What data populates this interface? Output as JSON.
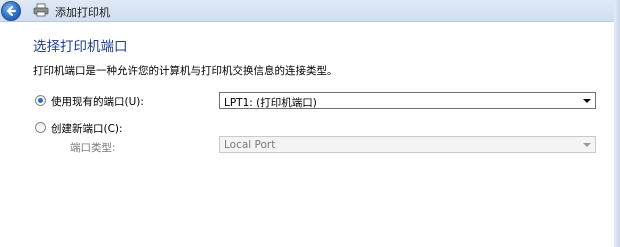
{
  "window": {
    "title": "添加打印机"
  },
  "page": {
    "heading": "选择打印机端口",
    "description": "打印机端口是一种允许您的计算机与打印机交换信息的连接类型。"
  },
  "options": {
    "use_existing": {
      "label": "使用现有的端口(U):",
      "selected": true,
      "value": "LPT1: (打印机端口)"
    },
    "create_new": {
      "label": "创建新端口(C):",
      "selected": false,
      "type_label": "端口类型:",
      "type_value": "Local Port"
    }
  },
  "colors": {
    "heading": "#1e3f8f",
    "radio_selected": "#2a6ebf"
  },
  "icons": {
    "back": "back-arrow-icon",
    "printer": "printer-icon"
  }
}
